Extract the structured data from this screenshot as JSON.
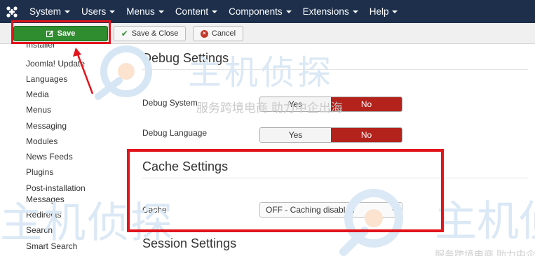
{
  "navbar": {
    "menu": [
      {
        "label": "System"
      },
      {
        "label": "Users"
      },
      {
        "label": "Menus"
      },
      {
        "label": "Content"
      },
      {
        "label": "Components"
      },
      {
        "label": "Extensions"
      },
      {
        "label": "Help"
      }
    ]
  },
  "toolbar": {
    "save_label": "Save",
    "save_close_label": "Save & Close",
    "cancel_label": "Cancel"
  },
  "sidebar": {
    "items": [
      {
        "label": "Installer"
      },
      {
        "label": "Joomla! Update"
      },
      {
        "label": "Languages"
      },
      {
        "label": "Media"
      },
      {
        "label": "Menus"
      },
      {
        "label": "Messaging"
      },
      {
        "label": "Modules"
      },
      {
        "label": "News Feeds"
      },
      {
        "label": "Plugins"
      },
      {
        "label": "Post-installation"
      },
      {
        "label": "Messages"
      },
      {
        "label": "Redirects"
      },
      {
        "label": "Search"
      },
      {
        "label": "Smart Search"
      }
    ]
  },
  "debug_settings": {
    "title": "Debug Settings",
    "debug_system": {
      "label": "Debug System",
      "yes": "Yes",
      "no": "No",
      "selected": "No"
    },
    "debug_language": {
      "label": "Debug Language",
      "yes": "Yes",
      "no": "No",
      "selected": "No"
    }
  },
  "cache_settings": {
    "title": "Cache Settings",
    "cache": {
      "label": "Cache",
      "value": "OFF - Caching disabled"
    }
  },
  "session_settings": {
    "title": "Session Settings"
  },
  "watermark": {
    "brand": "主机侦探",
    "slogan": "服务跨境电商 助力中企出海"
  },
  "colors": {
    "navbar": "#1d2f4b",
    "save_green": "#2f8c2f",
    "selected_red": "#b3221b",
    "annotation_red": "#e2141c"
  }
}
